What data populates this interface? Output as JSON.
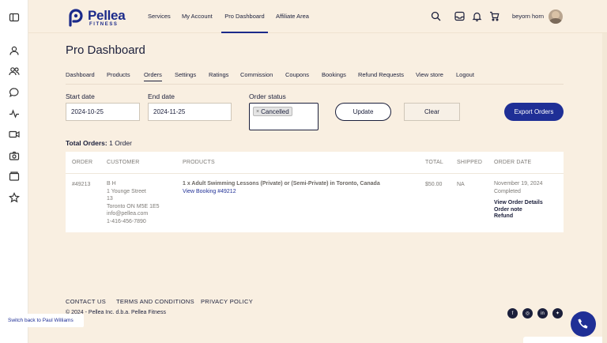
{
  "sidebar": {
    "icons": [
      "panel-icon",
      "user-icon",
      "users-icon",
      "chat-icon",
      "activity-icon",
      "video-icon",
      "camera-icon",
      "folder-icon",
      "star-icon"
    ]
  },
  "header": {
    "logo_name": "Pellea",
    "logo_sub": "FITNESS",
    "nav": [
      "Services",
      "My Account",
      "Pro Dashboard",
      "Affiliate Area"
    ],
    "active_nav": "Pro Dashboard",
    "username": "beyorn horn"
  },
  "page": {
    "title": "Pro Dashboard",
    "tabs": [
      "Dashboard",
      "Products",
      "Orders",
      "Settings",
      "Ratings",
      "Commission",
      "Coupons",
      "Bookings",
      "Refund Requests",
      "View store",
      "Logout"
    ],
    "active_tab": "Orders"
  },
  "filters": {
    "start_label": "Start date",
    "start_value": "2024-10-25",
    "end_label": "End date",
    "end_value": "2024-11-25",
    "status_label": "Order status",
    "status_chip": "Cancelled",
    "update_label": "Update",
    "clear_label": "Clear",
    "export_label": "Export Orders"
  },
  "summary": {
    "total_label": "Total Orders:",
    "total_value": "1 Order"
  },
  "table": {
    "headers": [
      "ORDER",
      "CUSTOMER",
      "PRODUCTS",
      "TOTAL",
      "SHIPPED",
      "ORDER DATE"
    ],
    "rows": [
      {
        "order": "#49213",
        "customer": [
          "B H",
          "1 Younge Street",
          "13",
          "Toronto ON M5E 1E5",
          "info@pellea.com",
          "1-416-456-7890"
        ],
        "product": "1 x Adult Swimming Lessons (Private) or (Semi-Private) in Toronto, Canada",
        "booking_link": "View Booking #49212",
        "total": "$50.00",
        "shipped": "NA",
        "date": "November 19, 2024",
        "status": "Completed",
        "actions": [
          "View Order Details",
          "Order note",
          "Refund"
        ]
      }
    ]
  },
  "footer": {
    "links": [
      "CONTACT US",
      "TERMS AND CONDITIONS",
      "PRIVACY POLICY"
    ],
    "copyright": "© 2024 - Pellea Inc. d.b.a. Pellea Fitness",
    "social": [
      "facebook-icon",
      "instagram-icon",
      "linkedin-icon",
      "twitter-icon"
    ]
  },
  "switch_back": "Switch back to Paul Williams"
}
